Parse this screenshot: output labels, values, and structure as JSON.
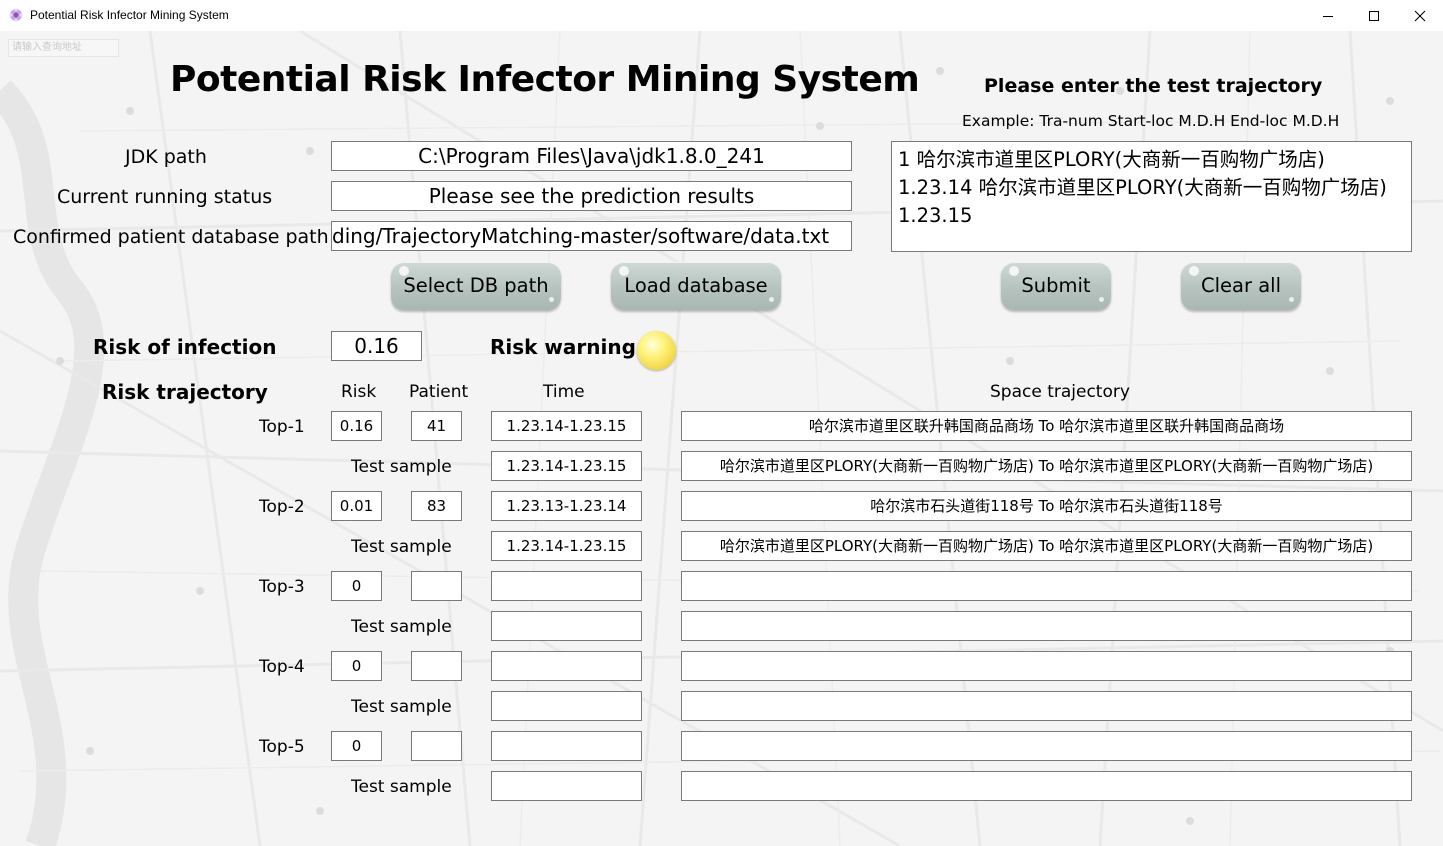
{
  "window": {
    "title": "Potential Risk Infector Mining System",
    "icon": "flower-app-icon"
  },
  "background": {
    "search_placeholder": "请输入查询地址"
  },
  "header": {
    "title": "Potential Risk Infector Mining System"
  },
  "settings": {
    "jdk_label": "JDK path",
    "jdk_value": "C:\\Program Files\\Java\\jdk1.8.0_241",
    "status_label": "Current running status",
    "status_value": "Please see the prediction results",
    "db_label": "Confirmed patient database path",
    "db_value": "ding/TrajectoryMatching-master/software/data.txt"
  },
  "test_input": {
    "heading": "Please enter the test trajectory",
    "example": "Example: Tra-num Start-loc M.D.H End-loc M.D.H",
    "value": "1 哈尔滨市道里区PLORY(大商新一百购物广场店) 1.23.14 哈尔滨市道里区PLORY(大商新一百购物广场店) 1.23.15"
  },
  "buttons": {
    "select_db": "Select DB path",
    "load_db": "Load database",
    "submit": "Submit",
    "clear_all": "Clear all"
  },
  "risk": {
    "infection_label": "Risk of infection",
    "infection_value": "0.16",
    "warning_label": "Risk warning",
    "warning_color": "#f7e45a",
    "trajectory_label": "Risk trajectory"
  },
  "table": {
    "headers": {
      "risk": "Risk",
      "patient": "Patient",
      "time": "Time",
      "space": "Space trajectory"
    },
    "test_sample_label": "Test sample",
    "rows": [
      {
        "label": "Top-1",
        "risk": "0.16",
        "patient": "41",
        "time": "1.23.14-1.23.15",
        "space": "哈尔滨市道里区联升韩国商品商场 To 哈尔滨市道里区联升韩国商品商场",
        "sample_time": "1.23.14-1.23.15",
        "sample_space": "哈尔滨市道里区PLORY(大商新一百购物广场店) To 哈尔滨市道里区PLORY(大商新一百购物广场店)"
      },
      {
        "label": "Top-2",
        "risk": "0.01",
        "patient": "83",
        "time": "1.23.13-1.23.14",
        "space": "哈尔滨市石头道街118号 To 哈尔滨市石头道街118号",
        "sample_time": "1.23.14-1.23.15",
        "sample_space": "哈尔滨市道里区PLORY(大商新一百购物广场店) To 哈尔滨市道里区PLORY(大商新一百购物广场店)"
      },
      {
        "label": "Top-3",
        "risk": "0",
        "patient": "",
        "time": "",
        "space": "",
        "sample_time": "",
        "sample_space": ""
      },
      {
        "label": "Top-4",
        "risk": "0",
        "patient": "",
        "time": "",
        "space": "",
        "sample_time": "",
        "sample_space": ""
      },
      {
        "label": "Top-5",
        "risk": "0",
        "patient": "",
        "time": "",
        "space": "",
        "sample_time": "",
        "sample_space": ""
      }
    ]
  }
}
